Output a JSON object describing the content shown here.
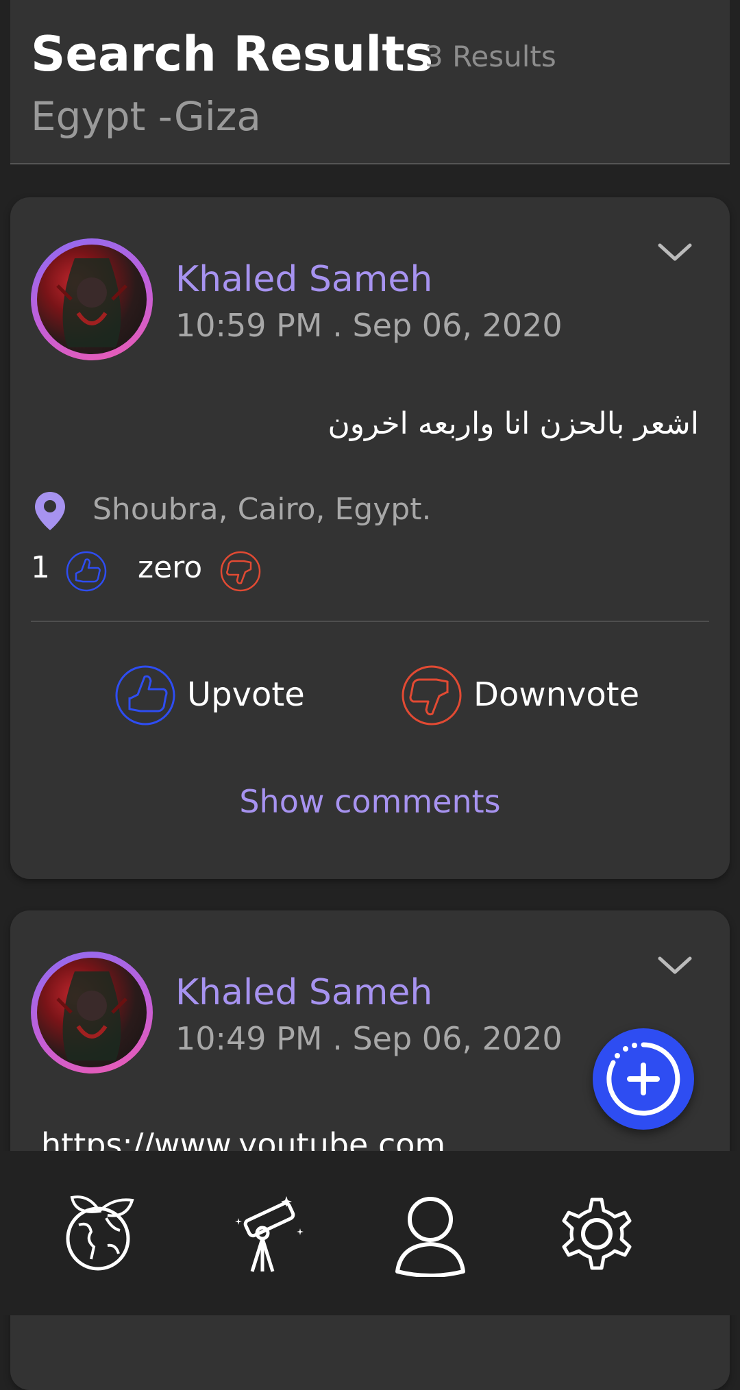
{
  "header": {
    "title": "Search Results",
    "result_count": "3 Results",
    "subtitle": "Egypt -Giza"
  },
  "posts": [
    {
      "author": "Khaled Sameh",
      "timestamp": "10:59 PM . Sep 06, 2020",
      "text": "اشعر بالحزن انا واربعه اخرون",
      "location": "Shoubra, Cairo, Egypt.",
      "upvotes": "1",
      "downvotes": "zero",
      "upvote_label": "Upvote",
      "downvote_label": "Downvote",
      "show_comments_label": "Show comments"
    },
    {
      "author": "Khaled Sameh",
      "timestamp": "10:49 PM . Sep 06, 2020",
      "text": "https://www.youtube.com"
    }
  ],
  "icons": {
    "expand": "chevron-down-icon",
    "location": "location-pin-icon",
    "upvote": "thumbs-up-icon",
    "downvote": "thumbs-down-icon",
    "fab": "add-post-icon",
    "nav": [
      "earth-leaf-icon",
      "telescope-icon",
      "user-icon",
      "gear-icon"
    ]
  },
  "colors": {
    "background": "#222222",
    "card": "#333333",
    "accent": "#a793f0",
    "upvote": "#2e4df2",
    "downvote": "#e24a33",
    "fab": "#2e4df2"
  }
}
